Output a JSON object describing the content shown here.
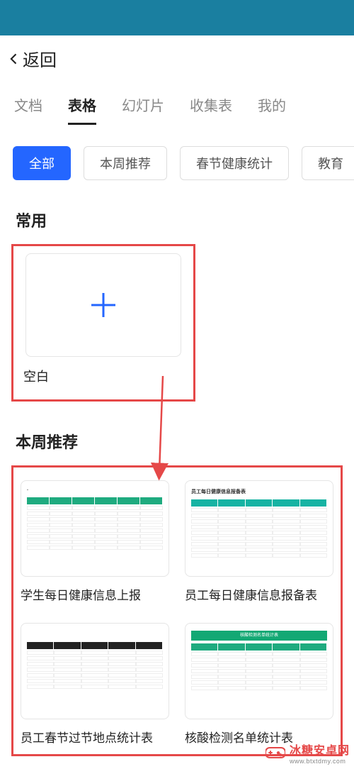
{
  "nav": {
    "back_label": "返回"
  },
  "tabs": [
    "文档",
    "表格",
    "幻灯片",
    "收集表",
    "我的"
  ],
  "active_tab_index": 1,
  "filters": [
    "全部",
    "本周推荐",
    "春节健康统计",
    "教育"
  ],
  "active_filter_index": 0,
  "sections": {
    "frequent": {
      "title": "常用",
      "blank_label": "空白"
    },
    "weekly": {
      "title": "本周推荐",
      "templates": [
        {
          "name": "学生每日健康信息上报"
        },
        {
          "name": "员工每日健康信息报备表",
          "thumb_title": "员工每日健康信息报备表"
        },
        {
          "name": "员工春节过节地点统计表"
        },
        {
          "name": "核酸检测名单统计表",
          "thumb_banner": "核酸检测名单统计表"
        }
      ]
    }
  },
  "watermark": {
    "text": "冰糖安卓网",
    "url": "www.btxtdmy.com"
  }
}
